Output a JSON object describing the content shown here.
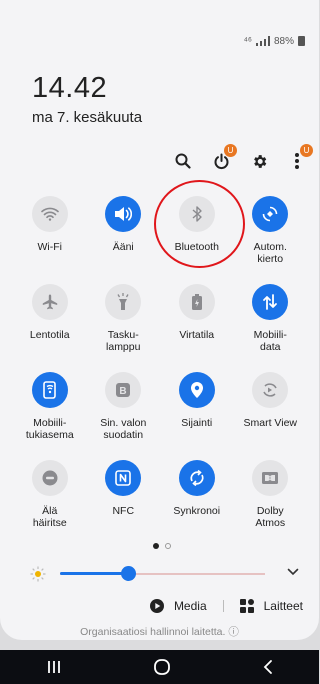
{
  "status": {
    "signal": "⁴⁶",
    "battery": "88%"
  },
  "clock": {
    "time": "14.42",
    "date": "ma 7. kesäkuuta"
  },
  "toolbar": {
    "power_badge": "U",
    "more_badge": "U"
  },
  "tiles": [
    {
      "label": "Wi-Fi",
      "icon": "wifi-icon",
      "on": false
    },
    {
      "label": "Ääni",
      "icon": "sound-icon",
      "on": true
    },
    {
      "label": "Bluetooth",
      "icon": "bluetooth-icon",
      "on": false
    },
    {
      "label": "Autom.\nkierto",
      "icon": "auto-rotate-icon",
      "on": true
    },
    {
      "label": "Lentotila",
      "icon": "airplane-icon",
      "on": false
    },
    {
      "label": "Tasku-\nlamppu",
      "icon": "flashlight-icon",
      "on": false
    },
    {
      "label": "Virtatila",
      "icon": "battery-mode-icon",
      "on": false
    },
    {
      "label": "Mobiili-\ndata",
      "icon": "mobile-data-icon",
      "on": true
    },
    {
      "label": "Mobiili-\ntukiasema",
      "icon": "hotspot-icon",
      "on": true
    },
    {
      "label": "Sin. valon\nsuodatin",
      "icon": "blue-light-icon",
      "on": false
    },
    {
      "label": "Sijainti",
      "icon": "location-icon",
      "on": true
    },
    {
      "label": "Smart View",
      "icon": "smart-view-icon",
      "on": false
    },
    {
      "label": "Älä\nhäiritse",
      "icon": "do-not-disturb-icon",
      "on": false
    },
    {
      "label": "NFC",
      "icon": "nfc-icon",
      "on": true
    },
    {
      "label": "Synkronoi",
      "icon": "sync-icon",
      "on": true
    },
    {
      "label": "Dolby\nAtmos",
      "icon": "dolby-icon",
      "on": false
    }
  ],
  "brightness": {
    "level": 0.33
  },
  "media": {
    "media_label": "Media",
    "devices_label": "Laitteet"
  },
  "footer": {
    "org_text": "Organisaatiosi hallinnoi laitetta. ⓘ"
  },
  "colors": {
    "accent": "#1a73e8",
    "badge": "#e87722",
    "highlight": "#e0161b"
  }
}
